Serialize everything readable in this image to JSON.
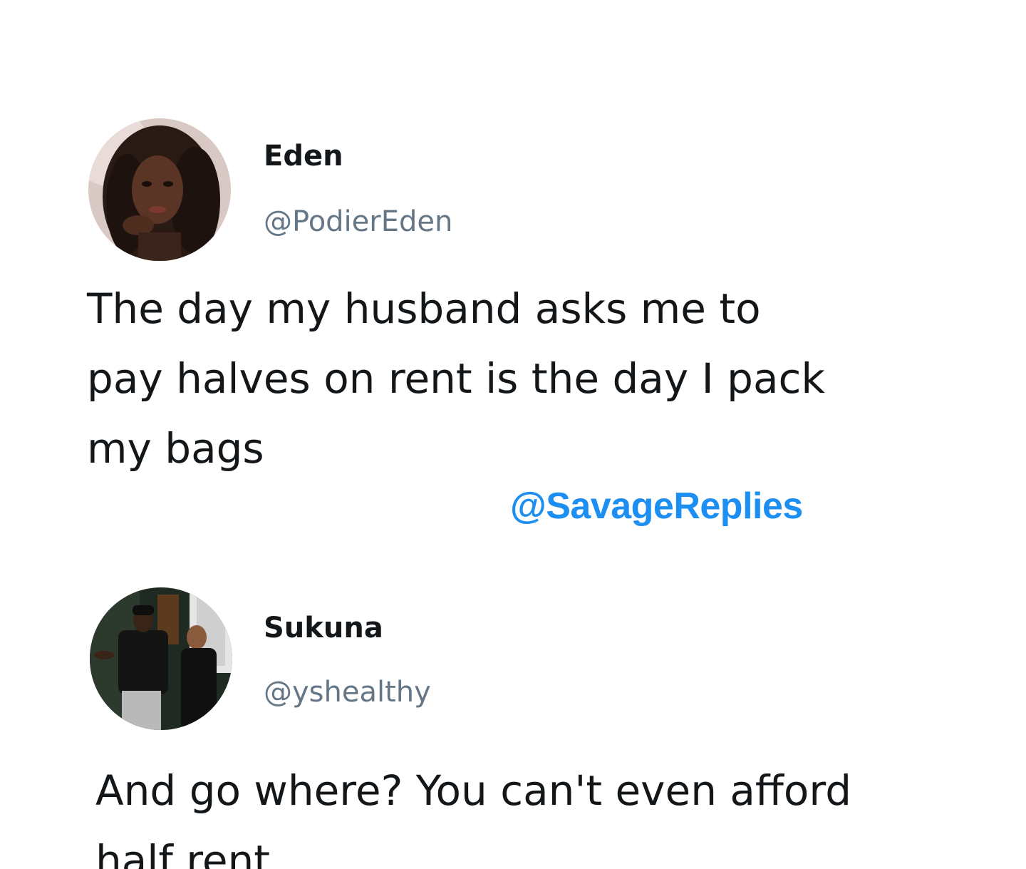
{
  "tweets": [
    {
      "display_name": "Eden",
      "handle": "@PodierEden",
      "text": "The day my husband asks me to\npay halves on rent is the day I pack\nmy bags",
      "avatar_icon": "avatar-photo-eden"
    },
    {
      "display_name": "Sukuna",
      "handle": "@yshealthy",
      "text": "And go where? You can't even afford\nhalf rent",
      "avatar_icon": "avatar-photo-sukuna"
    }
  ],
  "watermark": {
    "text": "@SavageReplies",
    "color": "#1d8ff2"
  },
  "colors": {
    "name": "#14171a",
    "handle": "#657786",
    "body": "#14171a",
    "background": "#ffffff"
  }
}
